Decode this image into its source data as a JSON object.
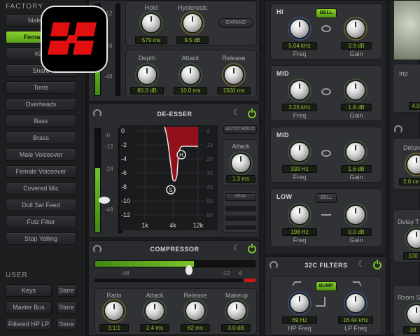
{
  "factory": {
    "title": "FACTORY",
    "presets": [
      "Male Vox",
      "Female Vox",
      "Kick",
      "Snare",
      "Toms",
      "Overheads",
      "Bass",
      "Brass",
      "Male Voiceover",
      "Female Voiceover",
      "Covered Mic",
      "Dull Sat Feed",
      "Futz Filter",
      "Stop Yelling"
    ],
    "active_index": 1
  },
  "user": {
    "title": "USER",
    "presets": [
      {
        "name": "Keys",
        "store": "Store"
      },
      {
        "name": "Master Bus",
        "store": "Store"
      },
      {
        "name": "Filtered HP LP",
        "store": "Store"
      }
    ]
  },
  "gate": {
    "meter_scale": [
      "-12",
      "-24",
      "-48"
    ],
    "hold": {
      "label": "Hold",
      "value": "579 ms"
    },
    "hysteresis": {
      "label": "Hysteresis",
      "value": "9.5 dB"
    },
    "expand_label": "EXPAND",
    "depth": {
      "label": "Depth",
      "value": "80.0 dB"
    },
    "attack": {
      "label": "Attack",
      "value": "10.0 ms"
    },
    "release": {
      "label": "Release",
      "value": "1500 ms"
    }
  },
  "deesser": {
    "title": "DE-ESSER",
    "auto_solo": "AUTO SOLO",
    "attack": {
      "label": "Attack",
      "value": "1.3 ms"
    },
    "mode": "PEAK",
    "meter_scale": [
      "-6",
      "-12",
      "-24",
      "-48"
    ],
    "graph_y": [
      "0",
      "-2",
      "-4",
      "-6",
      "-8",
      "-10",
      "-12"
    ],
    "graph_x": [
      "1k",
      "4k",
      "12k"
    ],
    "graph_right": [
      "0",
      "10",
      "20",
      "30",
      "40",
      "50",
      "60"
    ],
    "handle_h": "H",
    "handle_s": "S"
  },
  "compressor": {
    "title": "COMPRESSOR",
    "meter_scale": [
      "-48",
      "-12",
      "-6"
    ],
    "level": 0.62,
    "ratio": {
      "label": "Ratio",
      "value": "3.1:1"
    },
    "attack": {
      "label": "Attack",
      "value": "2.4 ms"
    },
    "release": {
      "label": "Release",
      "value": "62 ms"
    },
    "makeup": {
      "label": "Makeup",
      "value": "3.0 dB"
    }
  },
  "eq": {
    "hi": {
      "title": "HI",
      "mode": "BELL",
      "freq": {
        "label": "Freq",
        "value": "5.04 kHz"
      },
      "gain": {
        "label": "Gain",
        "value": "3.9 dB"
      }
    },
    "mid1": {
      "title": "MID",
      "freq": {
        "label": "Freq",
        "value": "3.25 kHz"
      },
      "gain": {
        "label": "Gain",
        "value": "1.9 dB"
      }
    },
    "mid2": {
      "title": "MID",
      "freq": {
        "label": "Freq",
        "value": "339 Hz"
      },
      "gain": {
        "label": "Gain",
        "value": "1.6 dB"
      }
    },
    "low": {
      "title": "LOW",
      "mode": "BELL",
      "freq": {
        "label": "Freq",
        "value": "198 Hz"
      },
      "gain": {
        "label": "Gain",
        "value": "0.0 dB"
      }
    }
  },
  "filters": {
    "title": "32C FILTERS",
    "bump": "BUMP",
    "hp": {
      "label": "HP Freq",
      "value": "69 Hz"
    },
    "lp": {
      "label": "LP Freq",
      "value": "16.44 kHz"
    }
  },
  "right": {
    "inp": "Inp",
    "inp_val": "4.0",
    "detune": "Detun",
    "detune_val": "2.0 ce",
    "delay": "Delay T",
    "delay_val": "100",
    "room": "Room S",
    "room_val": "38"
  },
  "colors": {
    "accent": "#7cc42a",
    "logo_red": "#e01010",
    "deesser_curve": "#a0101a"
  }
}
